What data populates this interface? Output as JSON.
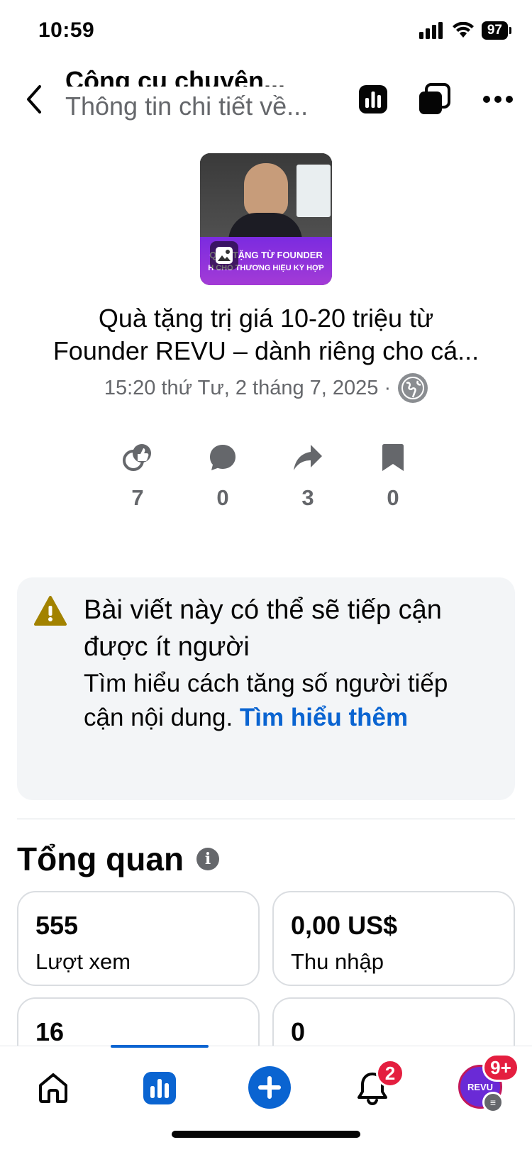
{
  "status_bar": {
    "time": "10:59",
    "battery": "97"
  },
  "header": {
    "title": "Công cụ chuyên...",
    "subtitle": "Thông tin chi tiết về..."
  },
  "thumbnail": {
    "line1": "QUÀ TẶNG TỪ FOUNDER",
    "line2": "H CHO THƯƠNG HIỆU KÝ HỢP"
  },
  "post": {
    "title_line1": "Quà tặng trị giá 10-20 triệu từ",
    "title_line2": "Founder REVU – dành riêng cho cá...",
    "meta": "15:20 thứ Tư, 2 tháng 7, 2025 ·"
  },
  "stats": {
    "reactions": "7",
    "comments": "0",
    "shares": "3",
    "saves": "0"
  },
  "notice": {
    "title": "Bài viết này có thể sẽ tiếp cận được ít người",
    "body": "Tìm hiểu cách tăng số người tiếp cận nội dung.",
    "link": "Tìm hiểu thêm"
  },
  "overview": {
    "title": "Tổng quan",
    "cards": [
      {
        "value": "555",
        "label": "Lượt xem"
      },
      {
        "value": "0,00 US$",
        "label": "Thu nhập"
      },
      {
        "value": "16",
        "label": ""
      },
      {
        "value": "0",
        "label": ""
      }
    ]
  },
  "tabbar": {
    "notif_count": "2",
    "menu_count": "9+",
    "avatar_text": "REVU"
  },
  "colors": {
    "accent": "#0a64d1",
    "badge": "#e41e3f",
    "warning": "#a28200"
  }
}
